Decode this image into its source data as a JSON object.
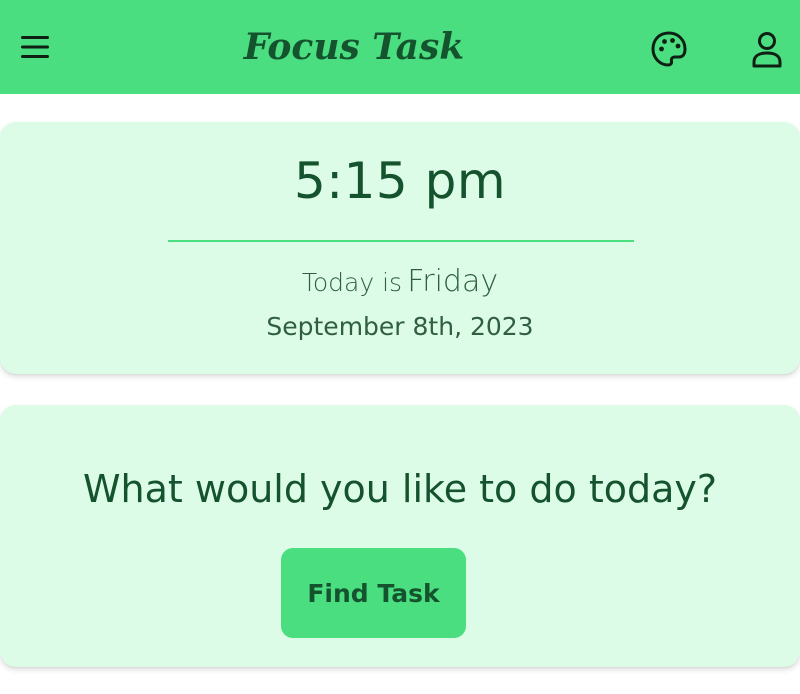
{
  "header": {
    "title": "Focus Task",
    "menu_icon": "hamburger-menu-icon",
    "theme_icon": "palette-icon",
    "profile_icon": "user-icon"
  },
  "clock": {
    "time": "5:15 pm",
    "today_prefix": "Today is",
    "day": "Friday",
    "date": "September 8th, 2023"
  },
  "prompt": {
    "question": "What would you like to do today?",
    "find_task_label": "Find Task"
  },
  "colors": {
    "accent": "#4ade80",
    "card_background": "#dcfce7",
    "text_primary": "#14532d"
  }
}
